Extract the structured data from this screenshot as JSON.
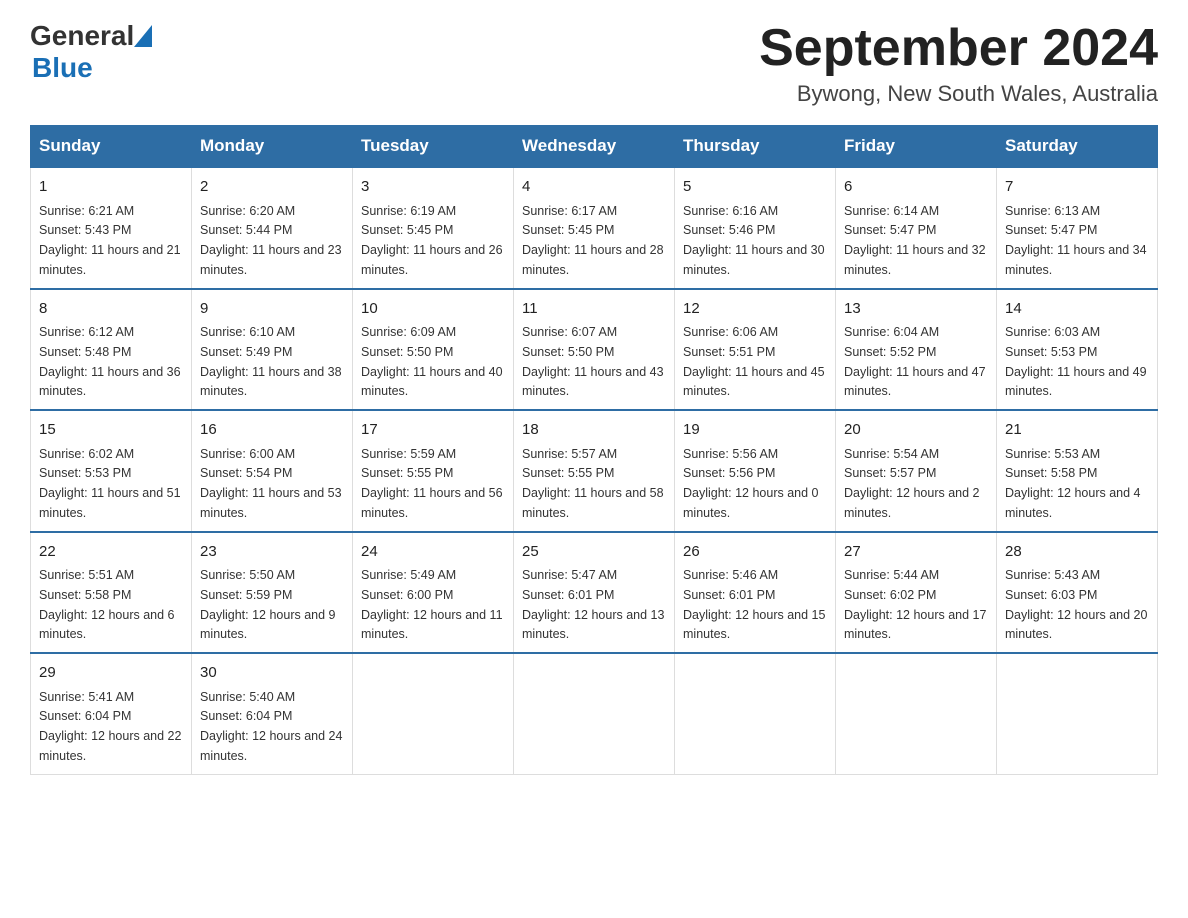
{
  "header": {
    "logo_general": "General",
    "logo_blue": "Blue",
    "title": "September 2024",
    "subtitle": "Bywong, New South Wales, Australia"
  },
  "days_of_week": [
    "Sunday",
    "Monday",
    "Tuesday",
    "Wednesday",
    "Thursday",
    "Friday",
    "Saturday"
  ],
  "weeks": [
    [
      {
        "day": "1",
        "sunrise": "6:21 AM",
        "sunset": "5:43 PM",
        "daylight": "11 hours and 21 minutes."
      },
      {
        "day": "2",
        "sunrise": "6:20 AM",
        "sunset": "5:44 PM",
        "daylight": "11 hours and 23 minutes."
      },
      {
        "day": "3",
        "sunrise": "6:19 AM",
        "sunset": "5:45 PM",
        "daylight": "11 hours and 26 minutes."
      },
      {
        "day": "4",
        "sunrise": "6:17 AM",
        "sunset": "5:45 PM",
        "daylight": "11 hours and 28 minutes."
      },
      {
        "day": "5",
        "sunrise": "6:16 AM",
        "sunset": "5:46 PM",
        "daylight": "11 hours and 30 minutes."
      },
      {
        "day": "6",
        "sunrise": "6:14 AM",
        "sunset": "5:47 PM",
        "daylight": "11 hours and 32 minutes."
      },
      {
        "day": "7",
        "sunrise": "6:13 AM",
        "sunset": "5:47 PM",
        "daylight": "11 hours and 34 minutes."
      }
    ],
    [
      {
        "day": "8",
        "sunrise": "6:12 AM",
        "sunset": "5:48 PM",
        "daylight": "11 hours and 36 minutes."
      },
      {
        "day": "9",
        "sunrise": "6:10 AM",
        "sunset": "5:49 PM",
        "daylight": "11 hours and 38 minutes."
      },
      {
        "day": "10",
        "sunrise": "6:09 AM",
        "sunset": "5:50 PM",
        "daylight": "11 hours and 40 minutes."
      },
      {
        "day": "11",
        "sunrise": "6:07 AM",
        "sunset": "5:50 PM",
        "daylight": "11 hours and 43 minutes."
      },
      {
        "day": "12",
        "sunrise": "6:06 AM",
        "sunset": "5:51 PM",
        "daylight": "11 hours and 45 minutes."
      },
      {
        "day": "13",
        "sunrise": "6:04 AM",
        "sunset": "5:52 PM",
        "daylight": "11 hours and 47 minutes."
      },
      {
        "day": "14",
        "sunrise": "6:03 AM",
        "sunset": "5:53 PM",
        "daylight": "11 hours and 49 minutes."
      }
    ],
    [
      {
        "day": "15",
        "sunrise": "6:02 AM",
        "sunset": "5:53 PM",
        "daylight": "11 hours and 51 minutes."
      },
      {
        "day": "16",
        "sunrise": "6:00 AM",
        "sunset": "5:54 PM",
        "daylight": "11 hours and 53 minutes."
      },
      {
        "day": "17",
        "sunrise": "5:59 AM",
        "sunset": "5:55 PM",
        "daylight": "11 hours and 56 minutes."
      },
      {
        "day": "18",
        "sunrise": "5:57 AM",
        "sunset": "5:55 PM",
        "daylight": "11 hours and 58 minutes."
      },
      {
        "day": "19",
        "sunrise": "5:56 AM",
        "sunset": "5:56 PM",
        "daylight": "12 hours and 0 minutes."
      },
      {
        "day": "20",
        "sunrise": "5:54 AM",
        "sunset": "5:57 PM",
        "daylight": "12 hours and 2 minutes."
      },
      {
        "day": "21",
        "sunrise": "5:53 AM",
        "sunset": "5:58 PM",
        "daylight": "12 hours and 4 minutes."
      }
    ],
    [
      {
        "day": "22",
        "sunrise": "5:51 AM",
        "sunset": "5:58 PM",
        "daylight": "12 hours and 6 minutes."
      },
      {
        "day": "23",
        "sunrise": "5:50 AM",
        "sunset": "5:59 PM",
        "daylight": "12 hours and 9 minutes."
      },
      {
        "day": "24",
        "sunrise": "5:49 AM",
        "sunset": "6:00 PM",
        "daylight": "12 hours and 11 minutes."
      },
      {
        "day": "25",
        "sunrise": "5:47 AM",
        "sunset": "6:01 PM",
        "daylight": "12 hours and 13 minutes."
      },
      {
        "day": "26",
        "sunrise": "5:46 AM",
        "sunset": "6:01 PM",
        "daylight": "12 hours and 15 minutes."
      },
      {
        "day": "27",
        "sunrise": "5:44 AM",
        "sunset": "6:02 PM",
        "daylight": "12 hours and 17 minutes."
      },
      {
        "day": "28",
        "sunrise": "5:43 AM",
        "sunset": "6:03 PM",
        "daylight": "12 hours and 20 minutes."
      }
    ],
    [
      {
        "day": "29",
        "sunrise": "5:41 AM",
        "sunset": "6:04 PM",
        "daylight": "12 hours and 22 minutes."
      },
      {
        "day": "30",
        "sunrise": "5:40 AM",
        "sunset": "6:04 PM",
        "daylight": "12 hours and 24 minutes."
      },
      null,
      null,
      null,
      null,
      null
    ]
  ],
  "labels": {
    "sunrise": "Sunrise:",
    "sunset": "Sunset:",
    "daylight": "Daylight:"
  }
}
